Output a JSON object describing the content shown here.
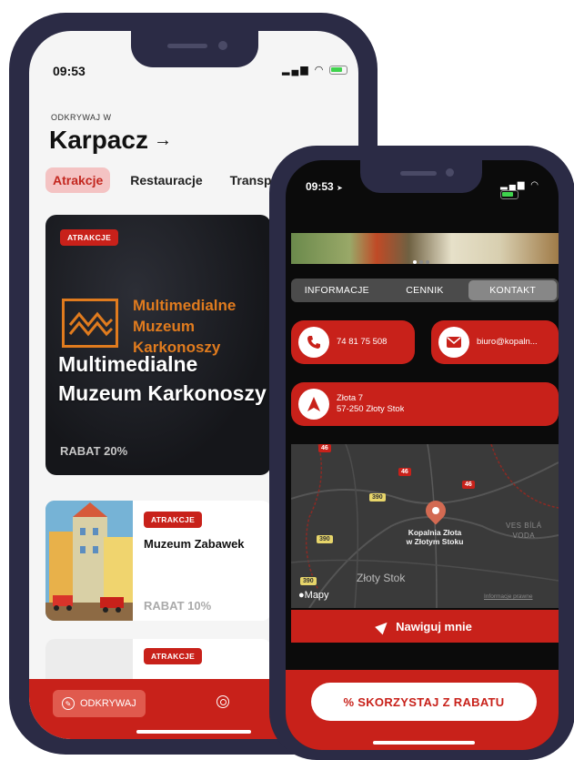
{
  "phone_back": {
    "status": {
      "time": "09:53"
    },
    "explore": {
      "label": "ODKRYWAJ W",
      "city": "Karpacz",
      "arrow": "→"
    },
    "tabs": [
      {
        "label": "Atrakcje",
        "active": true
      },
      {
        "label": "Restauracje",
        "active": false
      },
      {
        "label": "Transp",
        "active": false
      }
    ],
    "hero": {
      "badge": "ATRAKCJE",
      "logo_text": "Multimedialne Muzeum Karkonoszy",
      "title": "Multimedialne Muzeum Karkonoszy",
      "discount": "RABAT 20%"
    },
    "list": [
      {
        "badge": "ATRAKCJE",
        "title": "Muzeum Zabawek",
        "discount": "RABAT 10%"
      },
      {
        "badge": "ATRAKCJE"
      }
    ],
    "bottom_nav": {
      "explore_label": "ODKRYWAJ",
      "explore_icon": "compass-icon",
      "search_icon": "search-icon"
    }
  },
  "phone_front": {
    "status": {
      "time": "09:53",
      "location_arrow": "➤"
    },
    "segments": [
      {
        "label": "INFORMACJE",
        "active": false
      },
      {
        "label": "CENNIK",
        "active": false
      },
      {
        "label": "KONTAKT",
        "active": true
      }
    ],
    "contact": {
      "phone": "74 81 75 508",
      "email": "biuro@kopaln...",
      "address_line1": "Złota 7",
      "address_line2": "57-250 Złoty Stok"
    },
    "map": {
      "poi_line1": "Kopalnia Złota",
      "poi_line2": "w Złotym Stoku",
      "town": "Złoty Stok",
      "region_line1": "VES BÍLÁ",
      "region_line2": "VODA",
      "brand": "Mapy",
      "legal": "Informacje prawne",
      "road_labels": [
        "46",
        "46",
        "46",
        "390",
        "390",
        "390"
      ]
    },
    "navigate_label": "Nawiguj mnie",
    "discount_button": "% SKORZYSTAJ Z RABATU"
  },
  "colors": {
    "brand_red": "#c8211a",
    "frame": "#2b2b45",
    "accent_orange": "#e07b1e"
  }
}
